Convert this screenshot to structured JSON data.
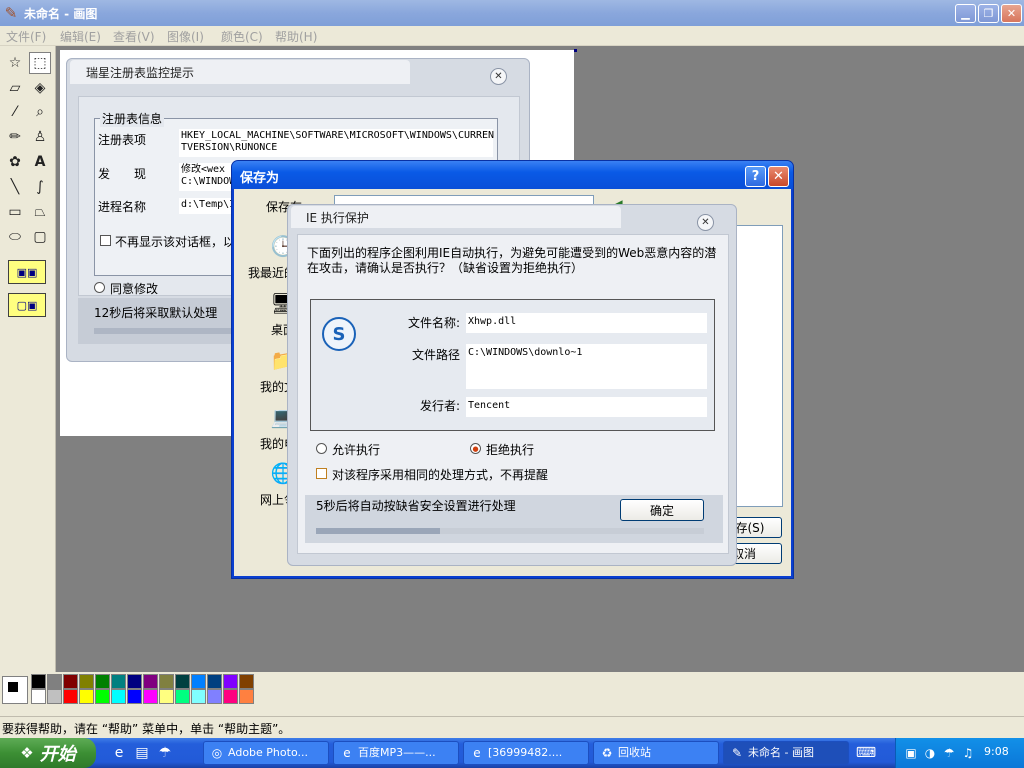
{
  "window": {
    "title": "未命名 - 画图"
  },
  "menu": [
    "文件(F)",
    "编辑(E)",
    "查看(V)",
    "图像(I)",
    "颜色(C)",
    "帮助(H)"
  ],
  "status": {
    "text": "要获得帮助，请在 “帮助” 菜单中，单击 “帮助主题”。"
  },
  "palette": {
    "row1": [
      "#000000",
      "#808080",
      "#800000",
      "#808000",
      "#008000",
      "#008080",
      "#000080",
      "#800080",
      "#808040",
      "#004040",
      "#0080ff",
      "#004080",
      "#8000ff",
      "#804000"
    ],
    "row2": [
      "#ffffff",
      "#c0c0c0",
      "#ff0000",
      "#ffff00",
      "#00ff00",
      "#00ffff",
      "#0000ff",
      "#ff00ff",
      "#ffff80",
      "#00ff80",
      "#80ffff",
      "#8080ff",
      "#ff0080",
      "#ff8040"
    ]
  },
  "rising": {
    "title": "瑞星注册表监控提示",
    "group_label": "注册表信息",
    "key_label": "注册表项",
    "key_value_line1": "HKEY_LOCAL_MACHINE\\SOFTWARE\\MICROSOFT\\WINDOWS\\CURREN",
    "key_value_line2": "TVERSION\\RUNONCE",
    "found_label": "发　　现",
    "found_value_line1": "修改<wex",
    "found_value_line2": "C:\\WINDOW",
    "process_label": "进程名称",
    "process_value": "d:\\Temp\\I",
    "dont_show_label": "不再显示该对话框，以",
    "agree_label": "同意修改",
    "countdown": "12秒后将采取默认处理"
  },
  "saveas": {
    "title": "保存为",
    "save_in_label": "保存在",
    "places": [
      "我最近的",
      "桌面",
      "我的文",
      "我的电",
      "网上邻"
    ],
    "save_button": "保存(S)",
    "cancel_button": "取消"
  },
  "ieprot": {
    "title": "IE 执行保护",
    "message": "下面列出的程序企图利用IE自动执行，为避免可能遭受到的Web恶意内容的潜在攻击，请确认是否执行？（缺省设置为拒绝执行）",
    "filename_label": "文件名称:",
    "filename_value": "Xhwp.dll",
    "filepath_label": "文件路径",
    "filepath_value": "C:\\WINDOWS\\downlo~1",
    "publisher_label": "发行者:",
    "publisher_value": "Tencent",
    "allow_label": "允许执行",
    "deny_label": "拒绝执行",
    "remember_label": "对该程序采用相同的处理方式，不再提醒",
    "countdown": "5秒后将自动按缺省安全设置进行处理",
    "ok_button": "确定"
  },
  "taskbar": {
    "start_label": "开始",
    "tasks": [
      "Adobe Photo...",
      "百度MP3——...",
      "[36999482....",
      "回收站",
      "未命名 - 画图"
    ],
    "clock": "9:08"
  }
}
